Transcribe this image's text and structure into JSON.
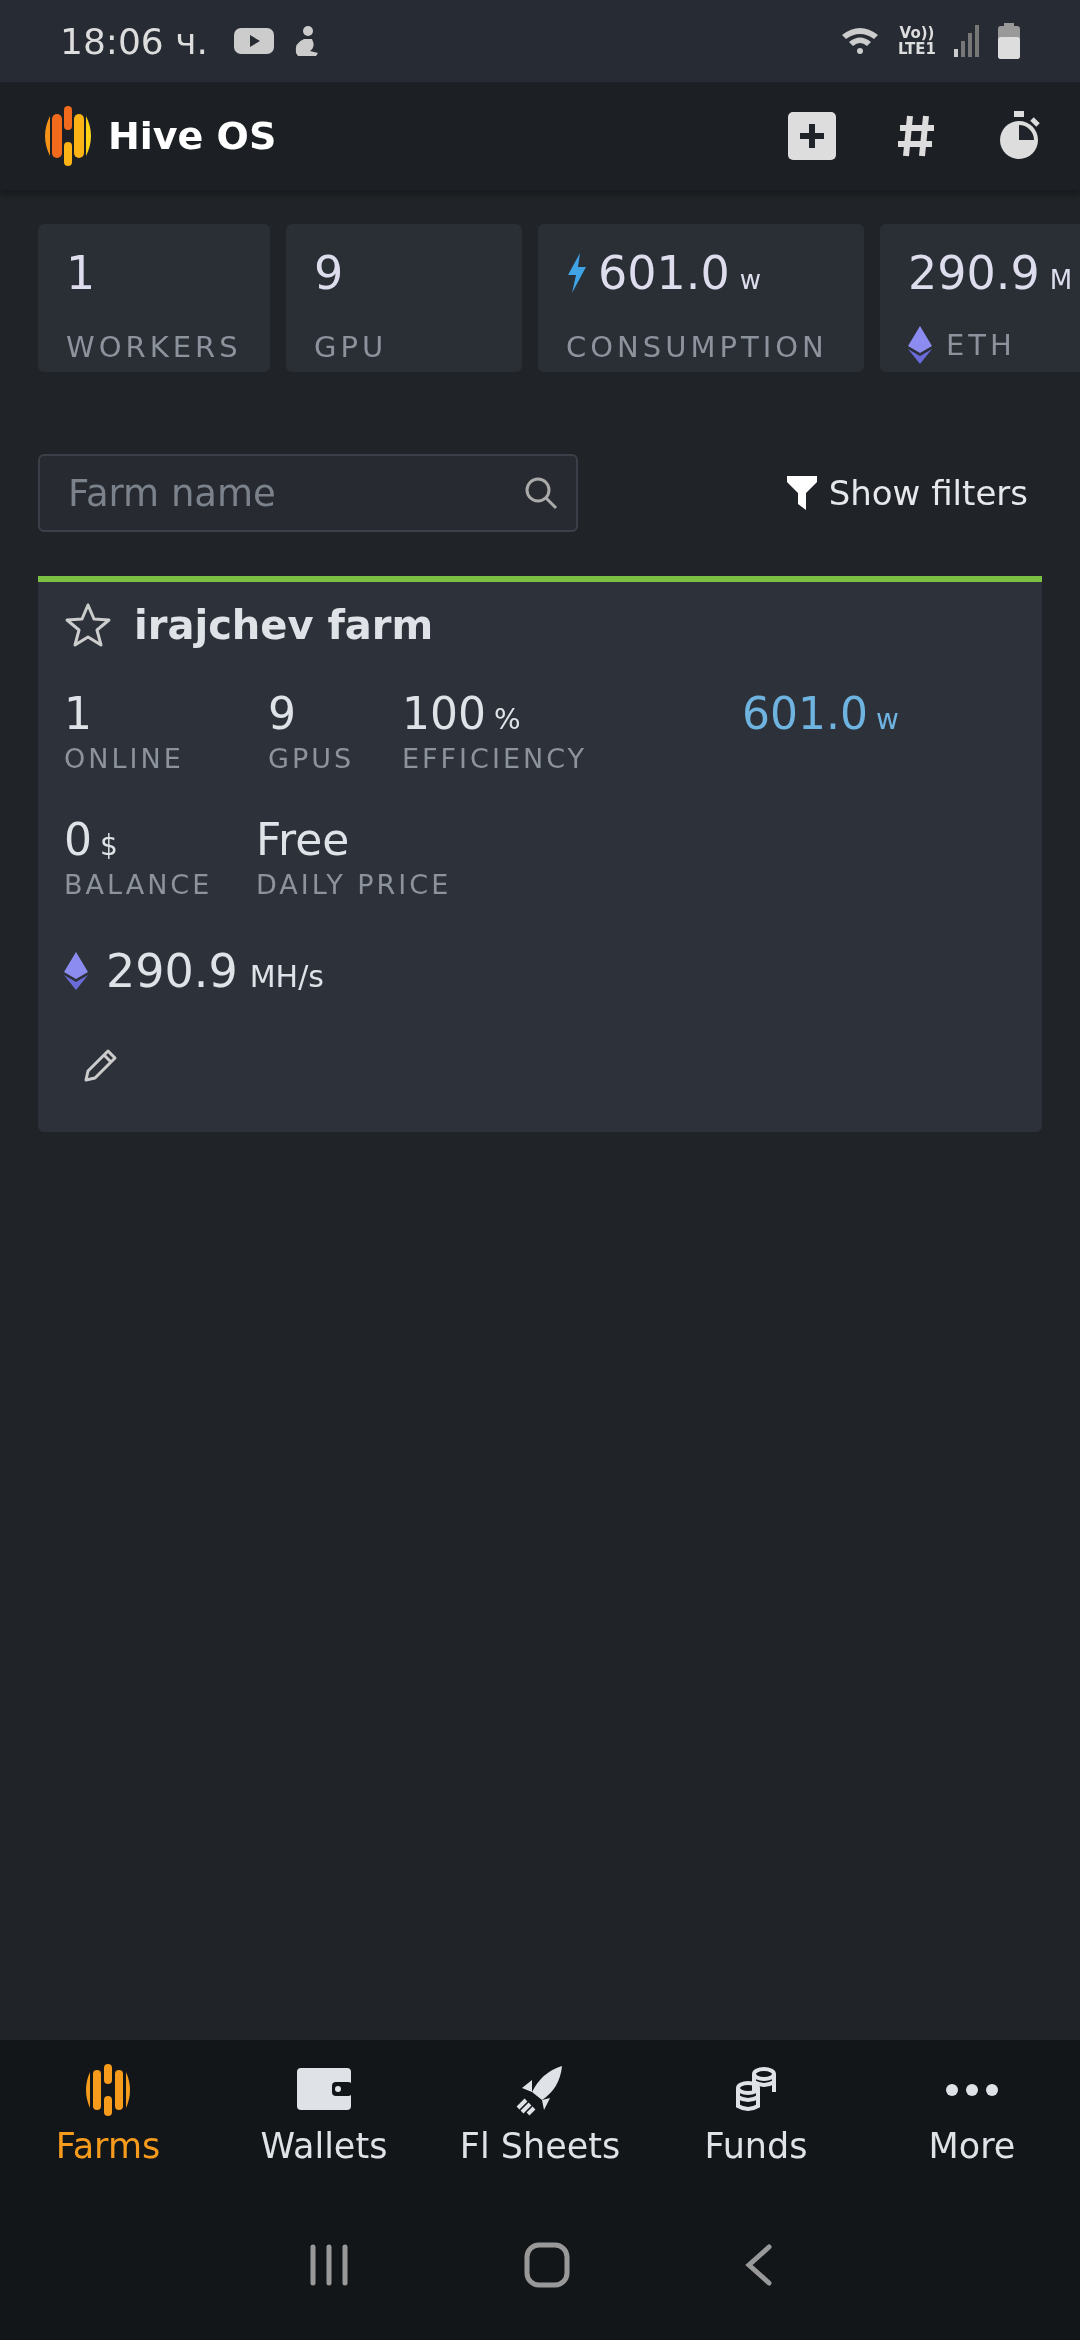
{
  "status_bar": {
    "time": "18:06 ч.",
    "network_top": "Vo))",
    "network_bottom": "LTE1"
  },
  "header": {
    "title": "Hive OS"
  },
  "summary": [
    {
      "value": "1",
      "label": "WORKERS",
      "kind": "plain"
    },
    {
      "value": "9",
      "label": "GPU",
      "kind": "plain"
    },
    {
      "value": "601.0",
      "unit": "w",
      "label": "CONSUMPTION",
      "kind": "power"
    },
    {
      "value": "290.9",
      "unit": "M",
      "label": "ETH",
      "kind": "eth"
    }
  ],
  "search": {
    "placeholder": "Farm name"
  },
  "filters_button": "Show filters",
  "farm": {
    "name": "irajchev farm",
    "favorite": false,
    "stats": [
      {
        "value": "1",
        "label": "ONLINE"
      },
      {
        "value": "9",
        "label": "GPUS"
      },
      {
        "value": "100",
        "unit": "%",
        "label": "EFFICIENCY"
      }
    ],
    "power": {
      "value": "601.0",
      "unit": "w"
    },
    "stats2": [
      {
        "value": "0",
        "unit": "$",
        "label": "BALANCE"
      },
      {
        "value": "Free",
        "label": "DAILY PRICE"
      }
    ],
    "hashrate": {
      "value": "290.9",
      "unit": "MH/s"
    }
  },
  "bottom_nav": [
    {
      "label": "Farms",
      "selected": true
    },
    {
      "label": "Wallets",
      "selected": false
    },
    {
      "label": "Fl Sheets",
      "selected": false
    },
    {
      "label": "Funds",
      "selected": false
    },
    {
      "label": "More",
      "selected": false
    }
  ]
}
